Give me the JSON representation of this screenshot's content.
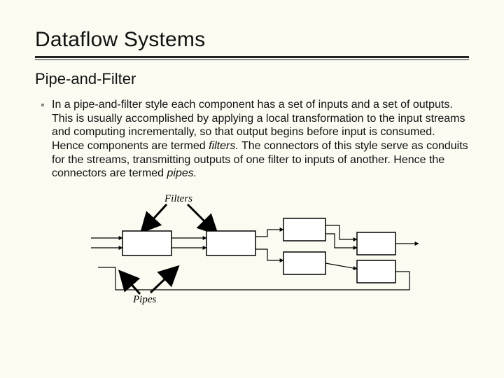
{
  "title": "Dataflow Systems",
  "subtitle": "Pipe-and-Filter",
  "body_pre": "In a pipe-and-filter style each component has a set of inputs and a set of outputs. This is usually accomplished by applying a local transformation to the input streams and computing incrementally, so that output begins before input is consumed. Hence components are termed ",
  "body_em1": "filters.",
  "body_mid": " The connectors of this style serve as conduits for the streams, transmitting outputs of one filter to inputs of another. Hence the connectors are termed ",
  "body_em2": "pipes.",
  "diagram": {
    "label_filters": "Filters",
    "label_pipes": "Pipes"
  }
}
